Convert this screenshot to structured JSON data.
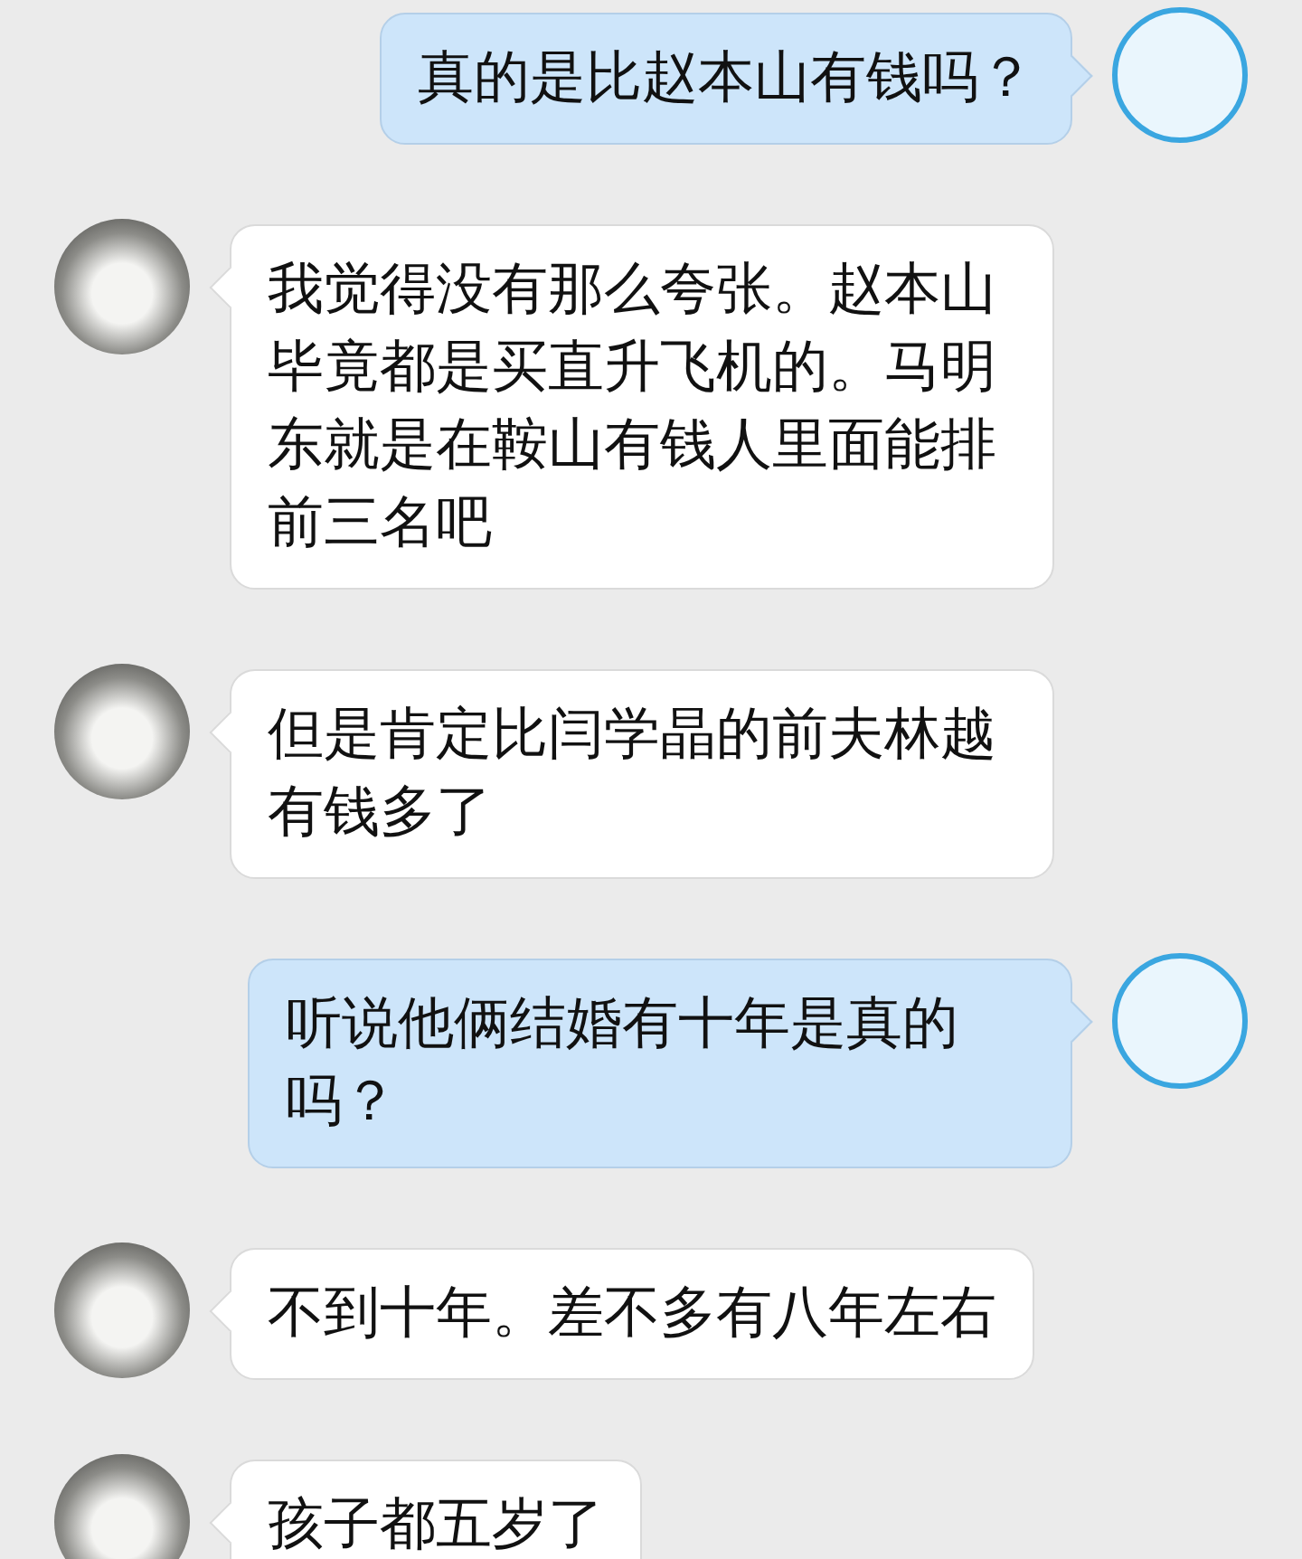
{
  "messages": [
    {
      "kind": "sent",
      "text": "真的是比赵本山有钱吗？"
    },
    {
      "kind": "received",
      "text": "我觉得没有那么夸张。赵本山毕竟都是买直升飞机的。马明东就是在鞍山有钱人里面能排前三名吧"
    },
    {
      "kind": "received",
      "text": "但是肯定比闫学晶的前夫林越有钱多了"
    },
    {
      "kind": "sent",
      "text": "听说他俩结婚有十年是真的吗？"
    },
    {
      "kind": "received",
      "text": "不到十年。差不多有八年左右"
    },
    {
      "kind": "received",
      "text": "孩子都五岁了"
    }
  ]
}
